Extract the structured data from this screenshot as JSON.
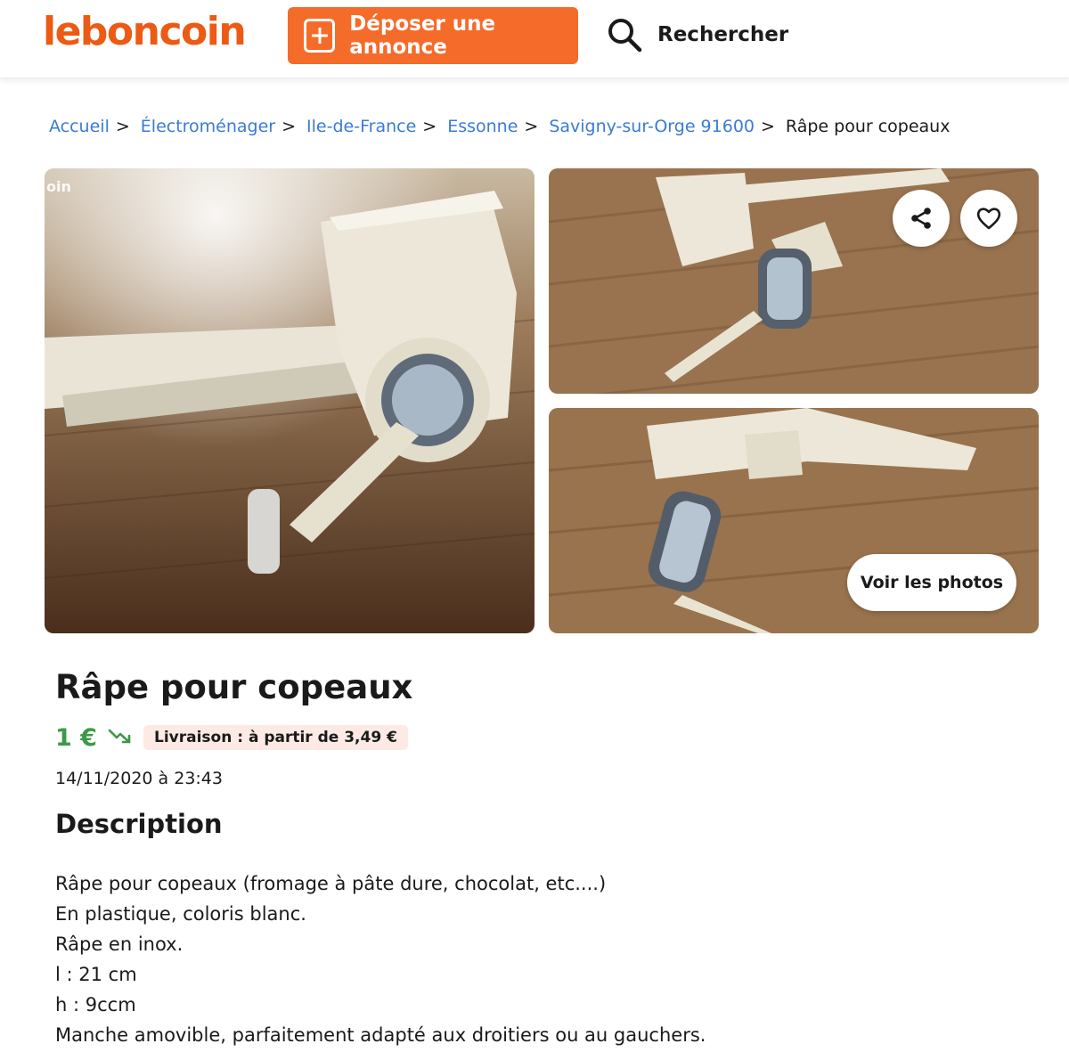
{
  "header": {
    "logo": "leboncoin",
    "deposit_label": "Déposer une annonce",
    "search_label": "Rechercher"
  },
  "breadcrumb": {
    "items": [
      "Accueil",
      "Électroménager",
      "Ile-de-France",
      "Essonne",
      "Savigny-sur-Orge 91600"
    ],
    "separator": ">",
    "current": "Râpe pour copeaux"
  },
  "gallery": {
    "watermark": "oin",
    "photos_button": "Voir les photos"
  },
  "ad": {
    "title": "Râpe pour copeaux",
    "price": "1 €",
    "delivery": "Livraison : à partir de 3,49 €",
    "date": "14/11/2020 à 23:43",
    "description_title": "Description",
    "description_lines": [
      "Râpe pour copeaux (fromage à pâte dure, chocolat, etc....)",
      "En plastique, coloris blanc.",
      "Râpe en inox.",
      "l : 21 cm",
      "h : 9ccm",
      "Manche amovible, parfaitement adapté aux droitiers ou au gauchers."
    ]
  },
  "colors": {
    "brand": "#ec5a13",
    "button": "#f56b2a",
    "link": "#3a7bd5",
    "price": "#3b9a4a",
    "delivery_bg": "#fdeae4"
  },
  "icons": [
    "plus-square-icon",
    "search-icon",
    "share-icon",
    "heart-icon",
    "trend-down-icon"
  ]
}
